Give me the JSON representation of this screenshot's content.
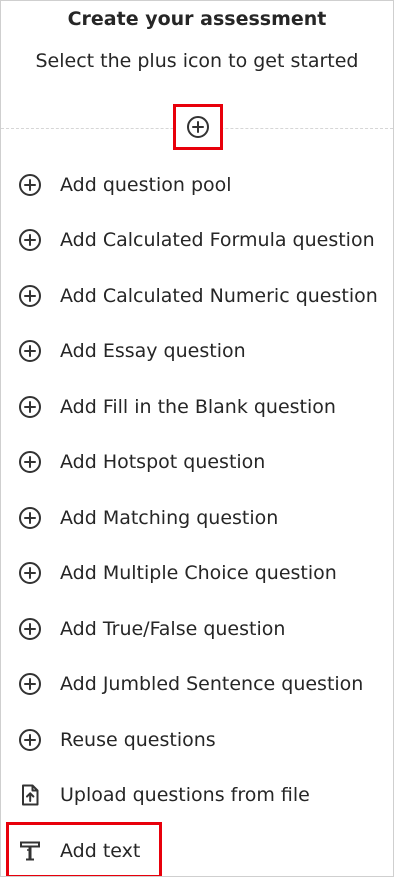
{
  "header": {
    "title": "Create your assessment",
    "subtitle": "Select the plus icon to get started"
  },
  "add_button": {
    "icon": "plus-circle-icon"
  },
  "menu": {
    "items": [
      {
        "label": "Add question pool",
        "icon": "plus-circle-icon"
      },
      {
        "label": "Add Calculated Formula question",
        "icon": "plus-circle-icon"
      },
      {
        "label": "Add Calculated Numeric question",
        "icon": "plus-circle-icon"
      },
      {
        "label": "Add Essay question",
        "icon": "plus-circle-icon"
      },
      {
        "label": "Add Fill in the Blank question",
        "icon": "plus-circle-icon"
      },
      {
        "label": "Add Hotspot question",
        "icon": "plus-circle-icon"
      },
      {
        "label": "Add Matching question",
        "icon": "plus-circle-icon"
      },
      {
        "label": "Add Multiple Choice question",
        "icon": "plus-circle-icon"
      },
      {
        "label": "Add True/False question",
        "icon": "plus-circle-icon"
      },
      {
        "label": "Add Jumbled Sentence question",
        "icon": "plus-circle-icon"
      },
      {
        "label": "Reuse questions",
        "icon": "plus-circle-icon"
      },
      {
        "label": "Upload questions from file",
        "icon": "upload-file-icon"
      },
      {
        "label": "Add text",
        "icon": "text-icon"
      }
    ]
  },
  "colors": {
    "text": "#262626",
    "icon": "#333333",
    "highlight": "#e8000b",
    "divider": "#d6d6d6",
    "border": "#cfcfcf"
  }
}
